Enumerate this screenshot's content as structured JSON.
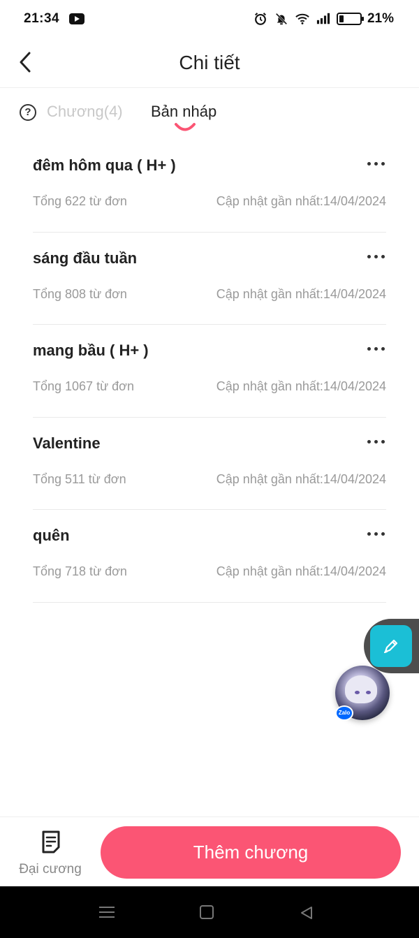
{
  "status_bar": {
    "time": "21:34",
    "battery_percent_text": "21%",
    "battery_level": 0.21,
    "icons": [
      "youtube-icon",
      "alarm-icon",
      "mute-icon",
      "wifi-icon",
      "signal-icon",
      "battery-icon"
    ]
  },
  "header": {
    "title": "Chi tiết",
    "back_icon": "chevron-left-icon"
  },
  "tabs": {
    "help_icon_text": "?",
    "chapters_label": "Chương(4)",
    "drafts_label": "Bản nháp",
    "active_tab": "drafts"
  },
  "drafts": [
    {
      "title": "đêm hôm qua ( H+ )",
      "words": "Tổng 622 từ đơn",
      "updated": "Cập nhật gần nhất:14/04/2024"
    },
    {
      "title": "sáng đầu tuần",
      "words": "Tổng 808 từ đơn",
      "updated": "Cập nhật gần nhất:14/04/2024"
    },
    {
      "title": "mang bầu ( H+ )",
      "words": "Tổng 1067 từ đơn",
      "updated": "Cập nhật gần nhất:14/04/2024"
    },
    {
      "title": "Valentine",
      "words": "Tổng 511 từ đơn",
      "updated": "Cập nhật gần nhất:14/04/2024"
    },
    {
      "title": "quên",
      "words": "Tổng 718 từ đơn",
      "updated": "Cập nhật gần nhất:14/04/2024"
    }
  ],
  "floating": {
    "edit_icon": "pen-icon",
    "zalo_badge": "Zalo"
  },
  "bottom_bar": {
    "outline_label": "Đại cương",
    "add_chapter_label": "Thêm chương"
  },
  "colors": {
    "accent": "#fb5574",
    "edit_button": "#1bbfd6"
  }
}
